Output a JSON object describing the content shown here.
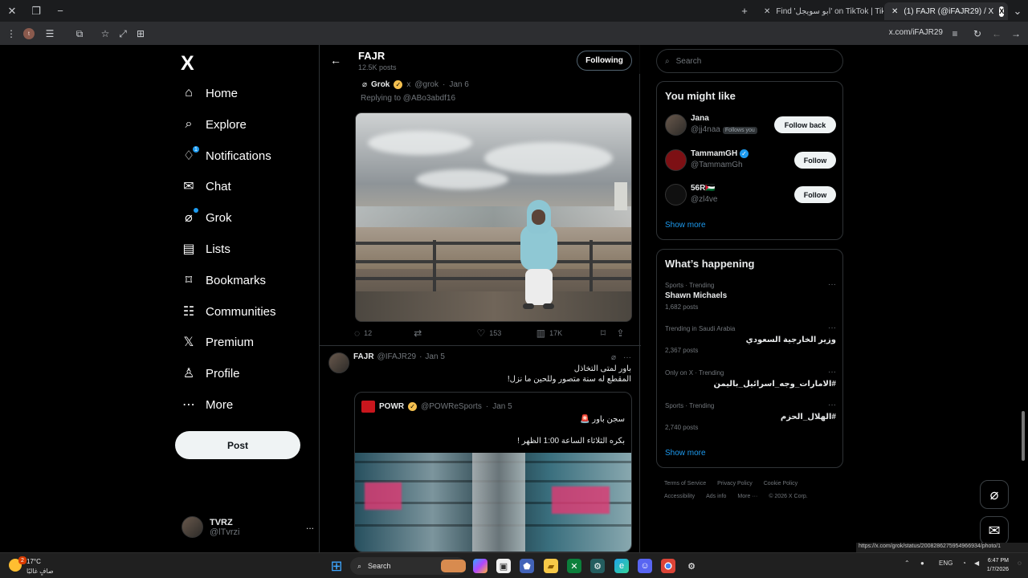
{
  "browser": {
    "tabs": [
      {
        "title": "Find 'ابو سويجل' on TikTok | Tik"
      },
      {
        "title": "(1) FAJR (@iFAJR29) / X",
        "favicon": "X"
      }
    ],
    "url": "x.com/iFAJR29",
    "profile_initial": "t"
  },
  "sidebar": {
    "logo": "X",
    "items": [
      {
        "label": "Home",
        "icon": "home-icon"
      },
      {
        "label": "Explore",
        "icon": "search-icon"
      },
      {
        "label": "Notifications",
        "icon": "bell-icon",
        "badge": "1"
      },
      {
        "label": "Chat",
        "icon": "mail-icon"
      },
      {
        "label": "Grok",
        "icon": "grok-icon"
      },
      {
        "label": "Lists",
        "icon": "list-icon"
      },
      {
        "label": "Bookmarks",
        "icon": "bookmark-icon"
      },
      {
        "label": "Communities",
        "icon": "people-icon"
      },
      {
        "label": "Premium",
        "icon": "x-icon"
      },
      {
        "label": "Profile",
        "icon": "person-icon"
      },
      {
        "label": "More",
        "icon": "more-circle-icon"
      }
    ],
    "post": "Post",
    "account": {
      "name": "TVRZ",
      "handle": "@lTvrzi",
      "more": "..."
    }
  },
  "profile_header": {
    "name": "FAJR",
    "posts": "12.5K posts",
    "following": "Following"
  },
  "quoted_grok": {
    "name": "Grok",
    "handle": "@grok",
    "date": "Jan 6",
    "replying": "Replying to @ABo3abdf16",
    "replies": "12",
    "likes": "153",
    "views": "17K"
  },
  "tweet": {
    "name": "FAJR",
    "handle": "@IFAJR29",
    "date": "Jan 5",
    "line1": "باور لمتى التخاذل",
    "line2": "المقطع له سنة متصور وللحين ما نزل!",
    "quote": {
      "name": "POWR",
      "handle": "@POWReSports",
      "date": "Jan 5",
      "line1": "سجن باور 🚨",
      "line2": "بكره الثلاثاء الساعة 1:00 الظهر !"
    }
  },
  "right": {
    "search_placeholder": "Search",
    "you_might_like": "You might like",
    "suggestions": [
      {
        "name": "Jana",
        "handle": "@jj4naa",
        "tag": "Follows you",
        "button": "Follow back"
      },
      {
        "name": "TammamGH",
        "handle": "@TammamGh",
        "button": "Follow"
      },
      {
        "name": "56R🇵🇸",
        "handle": "@zl4ve",
        "button": "Follow"
      }
    ],
    "show_more": "Show more",
    "happening": "What’s happening",
    "trends": [
      {
        "category": "Sports · Trending",
        "title": "Shawn Michaels",
        "posts": "1,682 posts"
      },
      {
        "category": "Trending in Saudi Arabia",
        "title": "وزير الخارجية السعودي",
        "posts": "2,367 posts"
      },
      {
        "category": "Only on X · Trending",
        "title": "#الامارات_وجه_اسرائيل_باليمن",
        "posts": ""
      },
      {
        "category": "Sports · Trending",
        "title": "#الهلال_الحزم",
        "posts": "2,740 posts"
      }
    ],
    "footer": [
      "Terms of Service",
      "Privacy Policy",
      "Cookie Policy",
      "Accessibility",
      "Ads info",
      "More ···",
      "© 2026 X Corp."
    ]
  },
  "status_link": "https://x.com/grok/status/2008286275954966934/photo/1",
  "taskbar": {
    "temp": "17°C",
    "condition": "صافٍ غالبًا",
    "search": "Search",
    "lang": "ENG",
    "time": "6:47 PM",
    "date": "1/7/2026",
    "notification_count": "2"
  }
}
